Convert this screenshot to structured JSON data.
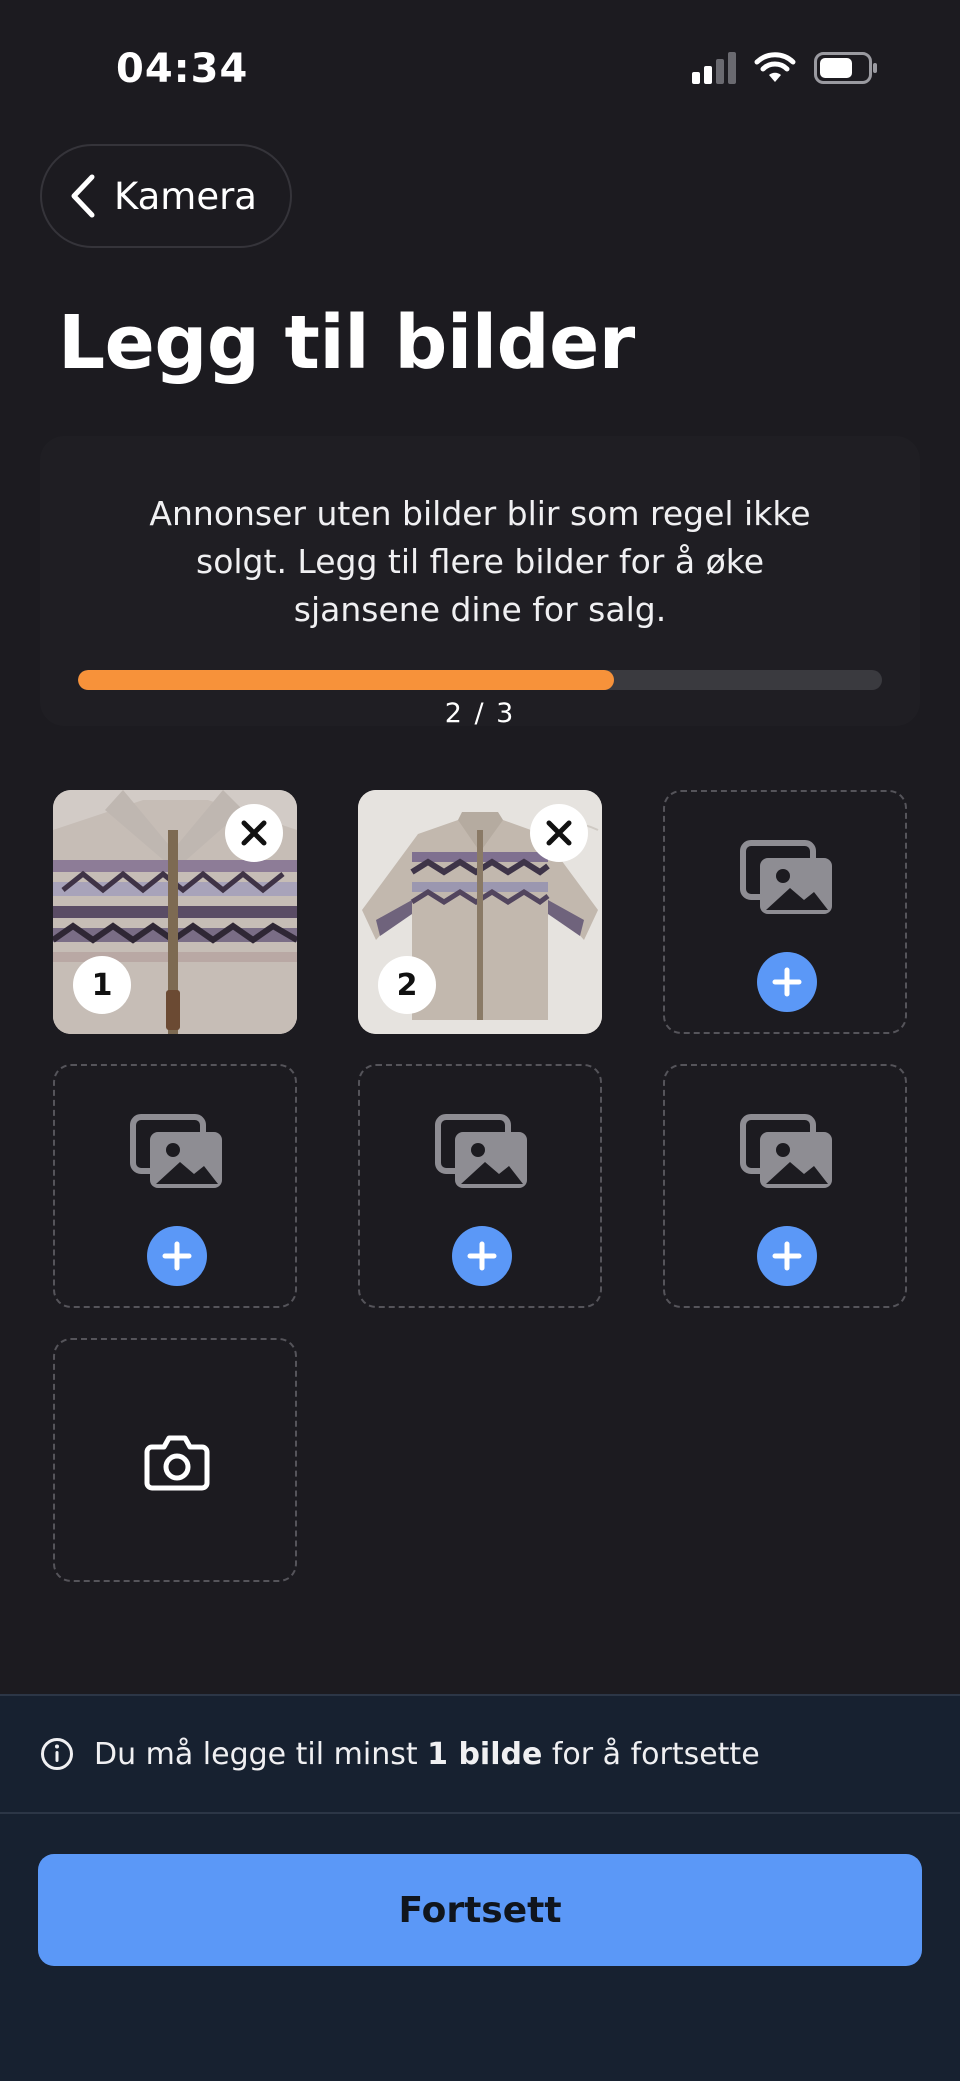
{
  "status_bar": {
    "time": "04:34"
  },
  "nav": {
    "back_label": "Kamera"
  },
  "page": {
    "title": "Legg til bilder"
  },
  "info_card": {
    "text": "Annonser uten bilder blir som regel ikke solgt. Legg til flere bilder for å øke sjansene dine for salg.",
    "progress_label": "2 / 3",
    "progress_fraction": 0.667,
    "progress_color": "#f7923a"
  },
  "photos": [
    {
      "number": "1"
    },
    {
      "number": "2"
    }
  ],
  "footer": {
    "notice_prefix": "Du må legge til minst ",
    "notice_bold": "1 bilde",
    "notice_suffix": " for å fortsette",
    "continue_label": "Fortsett"
  },
  "colors": {
    "accent": "#5b98f7",
    "background": "#1c1b20",
    "footer_bg": "#172130"
  },
  "icons": {
    "back": "chevron-left-icon",
    "remove": "close-icon",
    "empty_slot": "gallery-icon",
    "add": "plus-icon",
    "camera": "camera-icon",
    "info": "info-icon"
  }
}
